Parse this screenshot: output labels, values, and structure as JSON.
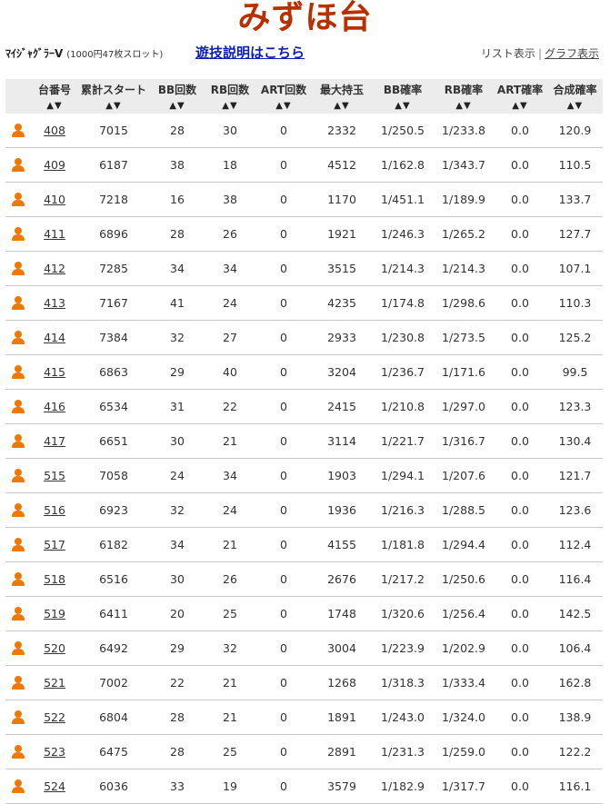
{
  "header": {
    "title": "みずほ台",
    "machine_name": "ﾏｲｼﾞｬｸﾞﾗｰV",
    "machine_note": "(1000円47枚スロット)",
    "guide_link": "遊技説明はこちら",
    "list_view": "リスト表示",
    "separator": "|",
    "graph_view": "グラフ表示"
  },
  "table": {
    "columns": [
      "台番号",
      "累計スタート",
      "BB回数",
      "RB回数",
      "ART回数",
      "最大持玉",
      "BB確率",
      "RB確率",
      "ART確率",
      "合成確率"
    ],
    "sort_glyph": "▲▼",
    "rows": [
      [
        "408",
        "7015",
        "28",
        "30",
        "0",
        "2332",
        "1/250.5",
        "1/233.8",
        "0.0",
        "120.9"
      ],
      [
        "409",
        "6187",
        "38",
        "18",
        "0",
        "4512",
        "1/162.8",
        "1/343.7",
        "0.0",
        "110.5"
      ],
      [
        "410",
        "7218",
        "16",
        "38",
        "0",
        "1170",
        "1/451.1",
        "1/189.9",
        "0.0",
        "133.7"
      ],
      [
        "411",
        "6896",
        "28",
        "26",
        "0",
        "1921",
        "1/246.3",
        "1/265.2",
        "0.0",
        "127.7"
      ],
      [
        "412",
        "7285",
        "34",
        "34",
        "0",
        "3515",
        "1/214.3",
        "1/214.3",
        "0.0",
        "107.1"
      ],
      [
        "413",
        "7167",
        "41",
        "24",
        "0",
        "4235",
        "1/174.8",
        "1/298.6",
        "0.0",
        "110.3"
      ],
      [
        "414",
        "7384",
        "32",
        "27",
        "0",
        "2933",
        "1/230.8",
        "1/273.5",
        "0.0",
        "125.2"
      ],
      [
        "415",
        "6863",
        "29",
        "40",
        "0",
        "3204",
        "1/236.7",
        "1/171.6",
        "0.0",
        "99.5"
      ],
      [
        "416",
        "6534",
        "31",
        "22",
        "0",
        "2415",
        "1/210.8",
        "1/297.0",
        "0.0",
        "123.3"
      ],
      [
        "417",
        "6651",
        "30",
        "21",
        "0",
        "3114",
        "1/221.7",
        "1/316.7",
        "0.0",
        "130.4"
      ],
      [
        "515",
        "7058",
        "24",
        "34",
        "0",
        "1903",
        "1/294.1",
        "1/207.6",
        "0.0",
        "121.7"
      ],
      [
        "516",
        "6923",
        "32",
        "24",
        "0",
        "1936",
        "1/216.3",
        "1/288.5",
        "0.0",
        "123.6"
      ],
      [
        "517",
        "6182",
        "34",
        "21",
        "0",
        "4155",
        "1/181.8",
        "1/294.4",
        "0.0",
        "112.4"
      ],
      [
        "518",
        "6516",
        "30",
        "26",
        "0",
        "2676",
        "1/217.2",
        "1/250.6",
        "0.0",
        "116.4"
      ],
      [
        "519",
        "6411",
        "20",
        "25",
        "0",
        "1748",
        "1/320.6",
        "1/256.4",
        "0.0",
        "142.5"
      ],
      [
        "520",
        "6492",
        "29",
        "32",
        "0",
        "3004",
        "1/223.9",
        "1/202.9",
        "0.0",
        "106.4"
      ],
      [
        "521",
        "7002",
        "22",
        "21",
        "0",
        "1268",
        "1/318.3",
        "1/333.4",
        "0.0",
        "162.8"
      ],
      [
        "522",
        "6804",
        "28",
        "21",
        "0",
        "1891",
        "1/243.0",
        "1/324.0",
        "0.0",
        "138.9"
      ],
      [
        "523",
        "6475",
        "28",
        "25",
        "0",
        "2891",
        "1/231.3",
        "1/259.0",
        "0.0",
        "122.2"
      ],
      [
        "524",
        "6036",
        "33",
        "19",
        "0",
        "3579",
        "1/182.9",
        "1/317.7",
        "0.0",
        "116.1"
      ]
    ]
  },
  "colors": {
    "title": "#b83000",
    "link": "#0a1fb0",
    "person_icon": "#f07800",
    "header_bg": "#ececec"
  },
  "icons": {
    "row_icon": "person-icon"
  }
}
